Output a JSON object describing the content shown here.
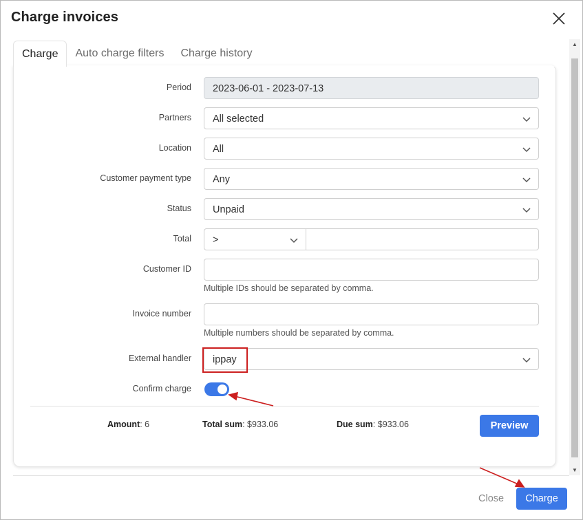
{
  "dialog": {
    "title": "Charge invoices"
  },
  "tabs": [
    {
      "label": "Charge"
    },
    {
      "label": "Auto charge filters"
    },
    {
      "label": "Charge history"
    }
  ],
  "form": {
    "period": {
      "label": "Period",
      "value": "2023-06-01 - 2023-07-13"
    },
    "partners": {
      "label": "Partners",
      "value": "All selected"
    },
    "location": {
      "label": "Location",
      "value": "All"
    },
    "payment_type": {
      "label": "Customer payment type",
      "value": "Any"
    },
    "status": {
      "label": "Status",
      "value": "Unpaid"
    },
    "total": {
      "label": "Total",
      "operator": ">",
      "value": ""
    },
    "customer_id": {
      "label": "Customer ID",
      "value": "",
      "help": "Multiple IDs should be separated by comma."
    },
    "invoice_number": {
      "label": "Invoice number",
      "value": "",
      "help": "Multiple numbers should be separated by comma."
    },
    "external_handler": {
      "label": "External handler",
      "value": "ippay"
    },
    "confirm_charge": {
      "label": "Confirm charge",
      "enabled": true
    }
  },
  "summary": {
    "amount_label": "Amount",
    "amount_value": ": 6",
    "total_label": "Total sum",
    "total_value": ": $933.06",
    "due_label": "Due sum",
    "due_value": ": $933.06"
  },
  "buttons": {
    "preview": "Preview",
    "close": "Close",
    "charge": "Charge"
  },
  "colors": {
    "accent": "#3b78e7",
    "annotation": "#cc1f1f"
  }
}
